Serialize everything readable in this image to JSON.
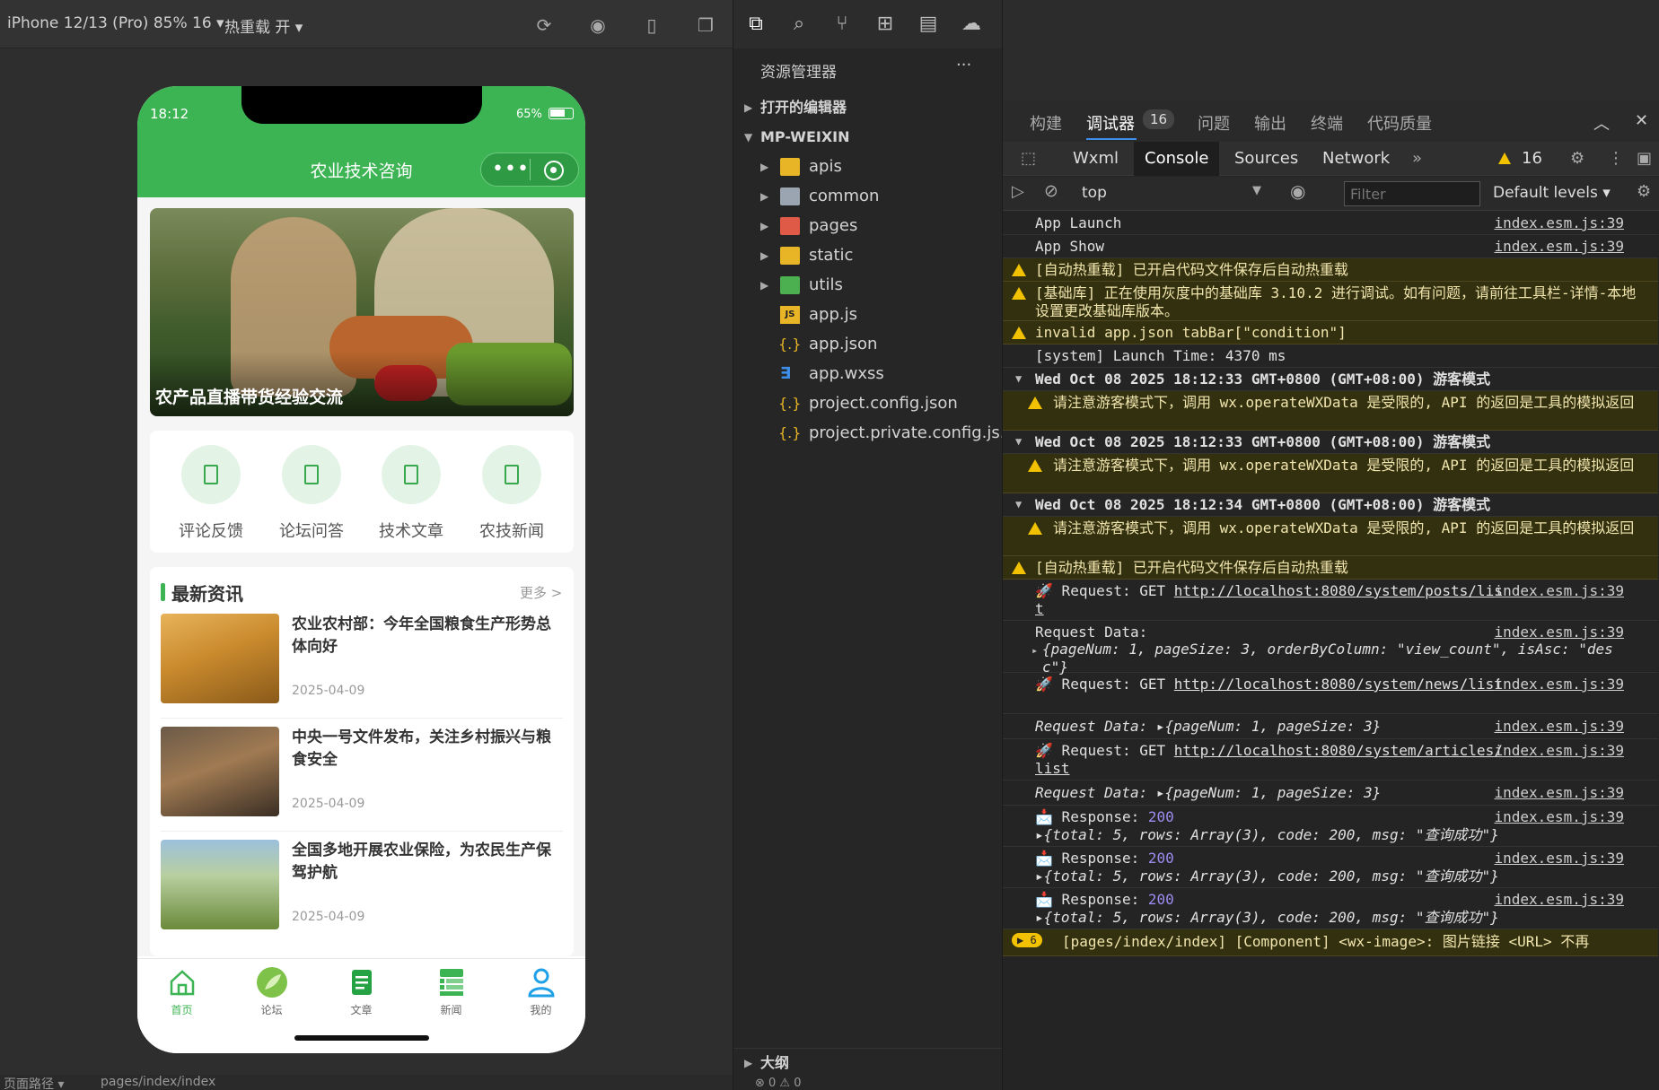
{
  "simulator": {
    "device_label": "iPhone 12/13 (Pro) 85% 16 ▾",
    "hotreload_label": "热重载 开 ▾",
    "bottom_path_label": "页面路径 ▾",
    "bottom_path": "pages/index/index"
  },
  "phone": {
    "time": "18:12",
    "battery": "65%",
    "nav_title": "农业技术咨询",
    "banner_caption": "农产品直播带货经验交流",
    "quick_items": [
      {
        "label": "评论反馈"
      },
      {
        "label": "论坛问答"
      },
      {
        "label": "技术文章"
      },
      {
        "label": "农技新闻"
      }
    ],
    "section_title": "最新资讯",
    "section_more": "更多 >",
    "news": [
      {
        "title": "农业农村部：今年全国粮食生产形势总体向好",
        "date": "2025-04-09"
      },
      {
        "title": "中央一号文件发布，关注乡村振兴与粮食安全",
        "date": "2025-04-09"
      },
      {
        "title": "全国多地开展农业保险，为农民生产保驾护航",
        "date": "2025-04-09"
      }
    ],
    "tabs": [
      {
        "label": "首页",
        "color": "#3db454"
      },
      {
        "label": "论坛",
        "color": "#666666"
      },
      {
        "label": "文章",
        "color": "#666666"
      },
      {
        "label": "新闻",
        "color": "#666666"
      },
      {
        "label": "我的",
        "color": "#666666"
      }
    ]
  },
  "explorer": {
    "title": "资源管理器",
    "more": "···",
    "open_editors": "打开的编辑器",
    "root": "MP-WEIXIN",
    "items": [
      {
        "name": "apis",
        "type": "folder",
        "color": "#e8b526"
      },
      {
        "name": "common",
        "type": "folder",
        "color": "#9aa5b1"
      },
      {
        "name": "pages",
        "type": "folder",
        "color": "#e05a48"
      },
      {
        "name": "static",
        "type": "folder",
        "color": "#e8b526"
      },
      {
        "name": "utils",
        "type": "folder",
        "color": "#4caf50"
      },
      {
        "name": "app.js",
        "type": "js"
      },
      {
        "name": "app.json",
        "type": "json"
      },
      {
        "name": "app.wxss",
        "type": "css"
      },
      {
        "name": "project.config.json",
        "type": "json"
      },
      {
        "name": "project.private.config.js...",
        "type": "json"
      }
    ],
    "outline": "大纲",
    "status": "⊗ 0 ⚠ 0"
  },
  "devtools": {
    "top_tabs": [
      {
        "label": "构建"
      },
      {
        "label": "调试器"
      },
      {
        "label": "问题"
      },
      {
        "label": "输出"
      },
      {
        "label": "终端"
      },
      {
        "label": "代码质量"
      }
    ],
    "debugger_badge": "16",
    "sub_tabs": [
      {
        "label": "Wxml"
      },
      {
        "label": "Console"
      },
      {
        "label": "Sources"
      },
      {
        "label": "Network"
      }
    ],
    "more_tabs": "»",
    "warn_count": "16",
    "context": "top",
    "filter_placeholder": "Filter",
    "levels": "Default levels",
    "src": "index.esm.js:39",
    "lines": {
      "l1": "App Launch",
      "l2": "App Show",
      "l3": "[自动热重载] 已开启代码文件保存后自动热重载",
      "l4": "[基础库] 正在使用灰度中的基础库 3.10.2 进行调试。如有问题，请前往工具栏-详情-本地设置更改基础库版本。",
      "l5": "invalid app.json tabBar[\"condition\"]",
      "l6": "[system] Launch Time: 4370 ms",
      "g1": "Wed Oct 08 2025 18:12:33 GMT+0800 (GMT+08:00) 游客模式",
      "w1": "请注意游客模式下，调用 wx.operateWXData 是受限的, API 的返回是工具的模拟返回",
      "g2": "Wed Oct 08 2025 18:12:33 GMT+0800 (GMT+08:00) 游客模式",
      "w2": "请注意游客模式下，调用 wx.operateWXData 是受限的, API 的返回是工具的模拟返回",
      "g3": "Wed Oct 08 2025 18:12:34 GMT+0800 (GMT+08:00) 游客模式",
      "w3": "请注意游客模式下，调用 wx.operateWXData 是受限的, API 的返回是工具的模拟返回",
      "l7": "[自动热重载] 已开启代码文件保存后自动热重载",
      "req1_prefix": "🚀 Request: GET ",
      "req1_url": "http://localhost:8080/system/posts/list",
      "reqdata_label": "Request Data:",
      "reqdata1": "{pageNum: 1, pageSize: 3, orderByColumn: \"view_count\", isAsc: \"desc\"}",
      "req2_prefix": "🚀 Request: GET ",
      "req2_url": "http://localhost:8080/system/news/list",
      "reqdata2": "Request Data: ▸{pageNum: 1, pageSize: 3}",
      "req3_prefix": "🚀 Request: GET ",
      "req3_url": "http://localhost:8080/system/articles/list",
      "reqdata3": "Request Data: ▸{pageNum: 1, pageSize: 3}",
      "resp_label": "📩 Response: ",
      "resp_code": "200",
      "resp_body": "▸{total: 5, rows: Array(3), code: 200, msg: \"查询成功\"}",
      "last_badge": "▶ 6",
      "last": "[pages/index/index] [Component] <wx-image>: 图片链接 <URL> 不再"
    }
  }
}
